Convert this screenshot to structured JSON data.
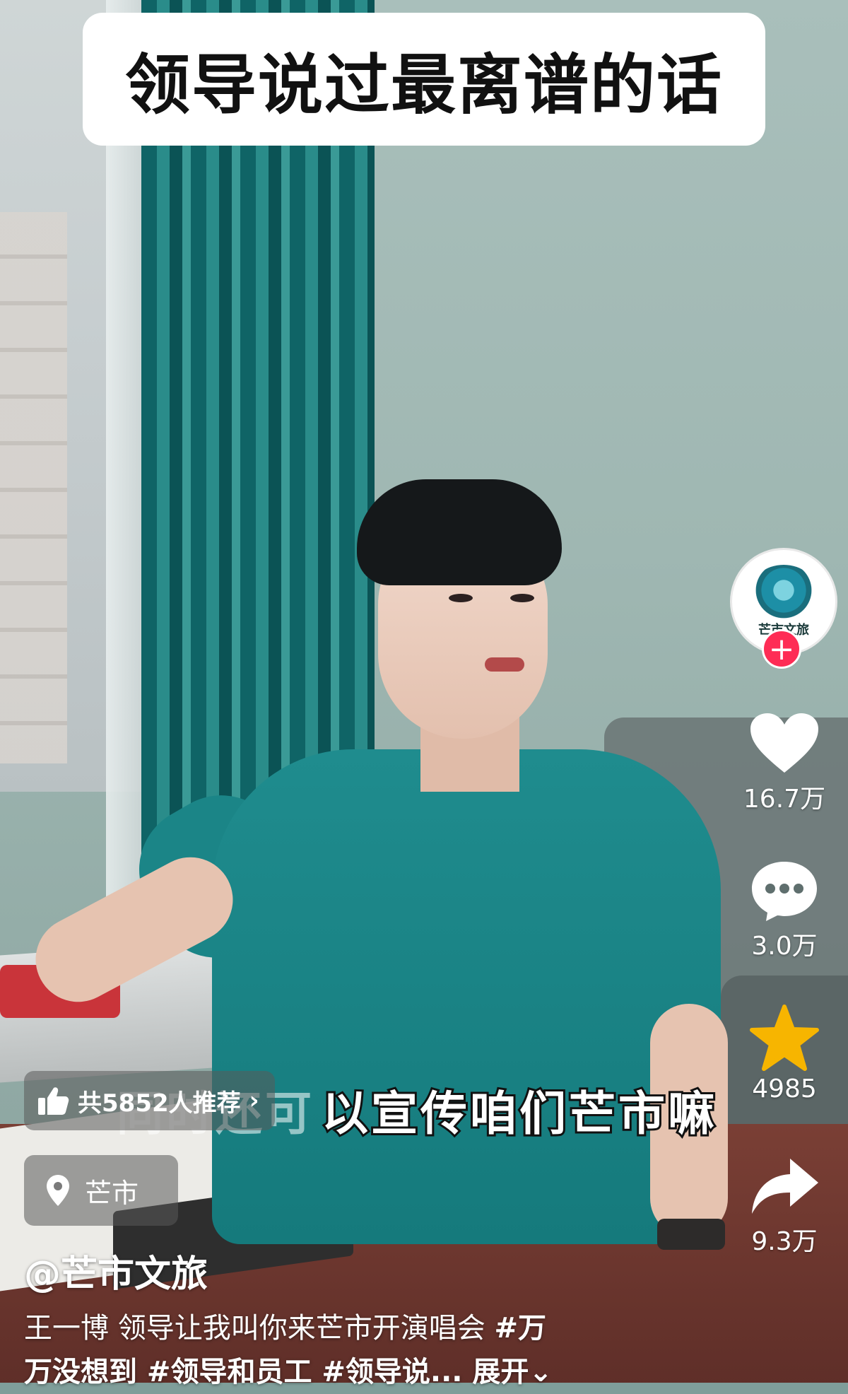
{
  "overlay_title": "领导说过最离谱的话",
  "subtitle": "以宣传咱们芒市嘛",
  "subtitle_faded": "同时还可",
  "author": {
    "avatar_label": "芒市文旅",
    "follow_symbol": "+"
  },
  "actions": [
    {
      "icon": "heart-icon",
      "count": "16.7万"
    },
    {
      "icon": "comment-icon",
      "count": "3.0万"
    },
    {
      "icon": "star-icon",
      "count": "4985"
    },
    {
      "icon": "share-icon",
      "count": "9.3万"
    }
  ],
  "recommend": {
    "text": "共5852人推荐",
    "chevron": "›"
  },
  "location": {
    "text": "芒市"
  },
  "username": "@芒市文旅",
  "description": {
    "line1_text": "王一博 领导让我叫你来芒市开演唱会 ",
    "line1_tag": "#万",
    "line2_tag_a": "万没想到",
    "line2_tag_b": " #领导和员工",
    "line2_tag_c": " #领导说...",
    "expand": " 展开",
    "expand_chevron": "⌄"
  },
  "colors": {
    "follow_red": "#fe2c55",
    "star_gold": "#f7b500",
    "curtain_teal": "#0f6466"
  }
}
